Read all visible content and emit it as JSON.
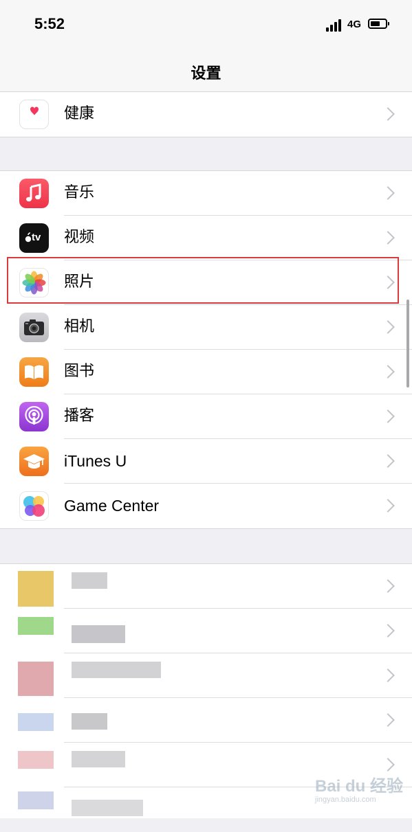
{
  "status": {
    "time": "5:52",
    "network": "4G"
  },
  "nav": {
    "title": "设置"
  },
  "group1": {
    "items": [
      {
        "label": "健康",
        "icon": "health-heart-icon"
      }
    ]
  },
  "group2": {
    "items": [
      {
        "label": "音乐",
        "icon": "music-icon"
      },
      {
        "label": "视频",
        "icon": "apple-tv-icon",
        "icon_text": "tv"
      },
      {
        "label": "照片",
        "icon": "photos-icon",
        "highlighted": true
      },
      {
        "label": "相机",
        "icon": "camera-icon"
      },
      {
        "label": "图书",
        "icon": "books-icon"
      },
      {
        "label": "播客",
        "icon": "podcasts-icon"
      },
      {
        "label": "iTunes U",
        "icon": "itunes-u-icon"
      },
      {
        "label": "Game Center",
        "icon": "game-center-icon"
      }
    ]
  },
  "group3": {
    "note": "pixelated third-party apps",
    "rows": 6
  },
  "watermark": {
    "brand": "Bai du 经验",
    "url": "jingyan.baidu.com"
  },
  "colors": {
    "highlight_border": "#d93a3a",
    "music": "#f2404f",
    "tv": "#111111",
    "books": "#f08a24",
    "podcasts": "#9b40d8",
    "itunesu": "#f07d22"
  }
}
